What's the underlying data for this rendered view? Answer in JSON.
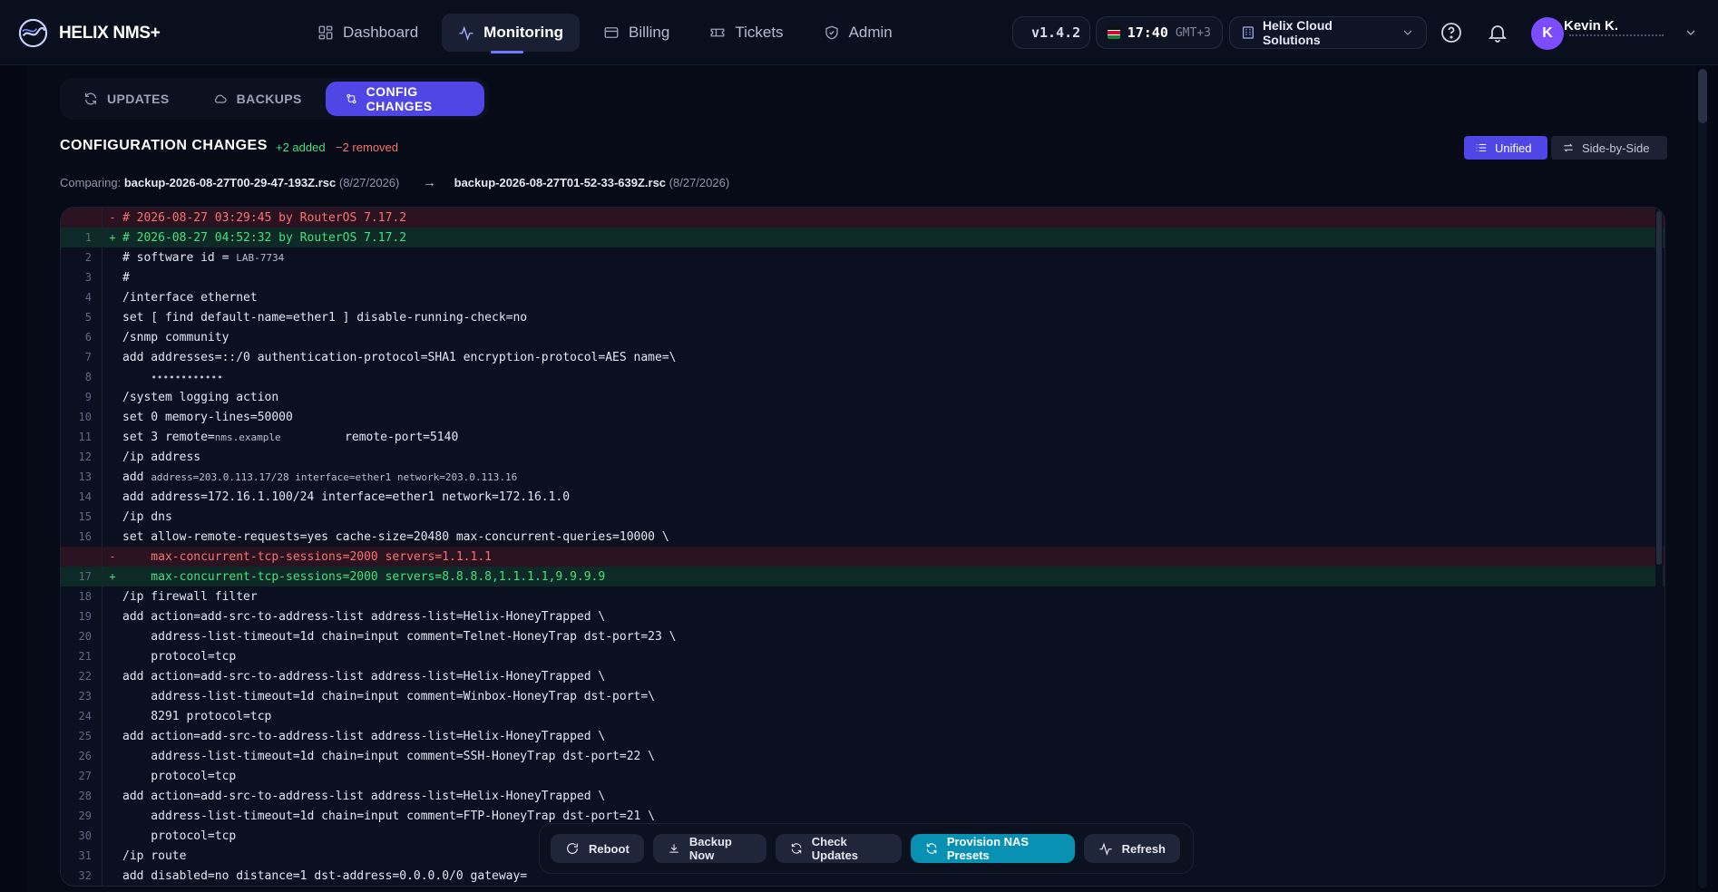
{
  "brand": {
    "name": "HELIX NMS+"
  },
  "nav": {
    "items": [
      {
        "label": "Dashboard",
        "icon": "grid-icon"
      },
      {
        "label": "Monitoring",
        "icon": "activity-icon",
        "active": true
      },
      {
        "label": "Billing",
        "icon": "card-icon"
      },
      {
        "label": "Tickets",
        "icon": "ticket-icon"
      },
      {
        "label": "Admin",
        "icon": "shield-icon"
      }
    ]
  },
  "header": {
    "version": "v1.4.2",
    "time": "17:40",
    "tz": "GMT+3",
    "org": "Helix Cloud Solutions",
    "user_initial": "K",
    "user_name": "Kevin K."
  },
  "subtabs": [
    {
      "label": "UPDATES",
      "icon": "refresh-icon"
    },
    {
      "label": "BACKUPS",
      "icon": "cloud-icon"
    },
    {
      "label": "CONFIG CHANGES",
      "icon": "git-compare-icon",
      "active": true
    }
  ],
  "changes": {
    "title": "CONFIGURATION CHANGES",
    "added": "+2 added",
    "removed": "−2 removed",
    "comparing_label": "Comparing:",
    "from_file": "backup-2026-08-27T00-29-47-193Z.rsc",
    "from_date": "(8/27/2026)",
    "to_file": "backup-2026-08-27T01-52-33-639Z.rsc",
    "to_date": "(8/27/2026)",
    "view_unified": "Unified",
    "view_side": "Side-by-Side"
  },
  "diff": [
    {
      "n": "",
      "t": "del",
      "text": "# 2026-08-27 03:29:45 by RouterOS 7.17.2"
    },
    {
      "n": "1",
      "t": "add",
      "text": "# 2026-08-27 04:52:32 by RouterOS 7.17.2"
    },
    {
      "n": "2",
      "t": "",
      "text": "# software id = ",
      "small": "LAB-7734"
    },
    {
      "n": "3",
      "t": "",
      "text": "#"
    },
    {
      "n": "4",
      "t": "",
      "text": "/interface ethernet"
    },
    {
      "n": "5",
      "t": "",
      "text": "set [ find default-name=ether1 ] disable-running-check=no"
    },
    {
      "n": "6",
      "t": "",
      "text": "/snmp community"
    },
    {
      "n": "7",
      "t": "",
      "text": "add addresses=::/0 authentication-protocol=SHA1 encryption-protocol=AES name=\\"
    },
    {
      "n": "8",
      "t": "",
      "text": "    ",
      "small": "••••••••••••"
    },
    {
      "n": "9",
      "t": "",
      "text": "/system logging action"
    },
    {
      "n": "10",
      "t": "",
      "text": "set 0 memory-lines=50000"
    },
    {
      "n": "11",
      "t": "",
      "text": "set 3 remote=",
      "small": "nms.example",
      "tail": "         remote-port=5140"
    },
    {
      "n": "12",
      "t": "",
      "text": "/ip address"
    },
    {
      "n": "13",
      "t": "",
      "text": "add ",
      "small": "address=203.0.113.17/28 interface=ether1 network=203.0.113.16"
    },
    {
      "n": "14",
      "t": "",
      "text": "add address=172.16.1.100/24 interface=ether1 network=172.16.1.0"
    },
    {
      "n": "15",
      "t": "",
      "text": "/ip dns"
    },
    {
      "n": "16",
      "t": "",
      "text": "set allow-remote-requests=yes cache-size=20480 max-concurrent-queries=10000 \\"
    },
    {
      "n": "",
      "t": "del",
      "text": "    max-concurrent-tcp-sessions=2000 servers=1.1.1.1"
    },
    {
      "n": "17",
      "t": "add",
      "text": "    max-concurrent-tcp-sessions=2000 servers=8.8.8.8,1.1.1.1,9.9.9.9"
    },
    {
      "n": "18",
      "t": "",
      "text": "/ip firewall filter"
    },
    {
      "n": "19",
      "t": "",
      "text": "add action=add-src-to-address-list address-list=Helix-HoneyTrapped \\"
    },
    {
      "n": "20",
      "t": "",
      "text": "    address-list-timeout=1d chain=input comment=Telnet-HoneyTrap dst-port=23 \\"
    },
    {
      "n": "21",
      "t": "",
      "text": "    protocol=tcp"
    },
    {
      "n": "22",
      "t": "",
      "text": "add action=add-src-to-address-list address-list=Helix-HoneyTrapped \\"
    },
    {
      "n": "23",
      "t": "",
      "text": "    address-list-timeout=1d chain=input comment=Winbox-HoneyTrap dst-port=\\"
    },
    {
      "n": "24",
      "t": "",
      "text": "    8291 protocol=tcp"
    },
    {
      "n": "25",
      "t": "",
      "text": "add action=add-src-to-address-list address-list=Helix-HoneyTrapped \\"
    },
    {
      "n": "26",
      "t": "",
      "text": "    address-list-timeout=1d chain=input comment=SSH-HoneyTrap dst-port=22 \\"
    },
    {
      "n": "27",
      "t": "",
      "text": "    protocol=tcp"
    },
    {
      "n": "28",
      "t": "",
      "text": "add action=add-src-to-address-list address-list=Helix-HoneyTrapped \\"
    },
    {
      "n": "29",
      "t": "",
      "text": "    address-list-timeout=1d chain=input comment=FTP-HoneyTrap dst-port=21 \\"
    },
    {
      "n": "30",
      "t": "",
      "text": "    protocol=tcp"
    },
    {
      "n": "31",
      "t": "",
      "text": "/ip route"
    },
    {
      "n": "32",
      "t": "",
      "text": "add disabled=no distance=1 dst-address=0.0.0.0/0 gateway="
    }
  ],
  "actions": [
    {
      "label": "Reboot",
      "icon": "rotate-icon"
    },
    {
      "label": "Backup Now",
      "icon": "download-icon"
    },
    {
      "label": "Check Updates",
      "icon": "refresh-icon"
    },
    {
      "label": "Provision NAS Presets",
      "icon": "refresh-icon",
      "primary": true
    },
    {
      "label": "Refresh",
      "icon": "activity-icon"
    }
  ],
  "colors": {
    "accent": "#4f46e5",
    "primary_action": "#0891b2",
    "added": "#4ade80",
    "removed": "#f87171"
  }
}
